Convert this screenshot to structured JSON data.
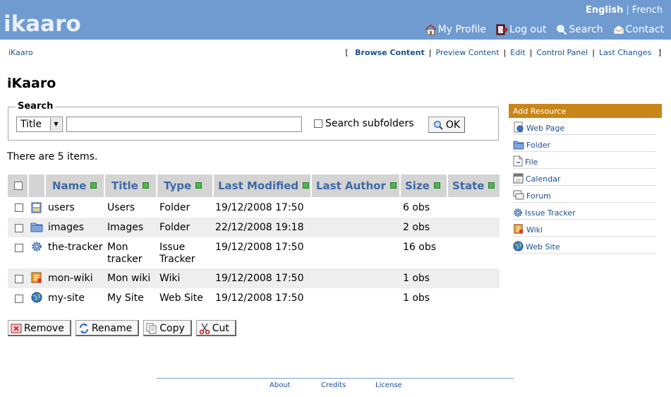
{
  "header": {
    "logo": "ikaaro",
    "languages": [
      {
        "label": "English",
        "active": true
      },
      {
        "label": "French",
        "active": false
      }
    ],
    "nav": [
      {
        "label": "My Profile",
        "icon": "house-icon"
      },
      {
        "label": "Log out",
        "icon": "logout-icon"
      },
      {
        "label": "Search",
        "icon": "search-icon"
      },
      {
        "label": "Contact",
        "icon": "contact-icon"
      }
    ]
  },
  "breadcrumb": "iKaaro",
  "views": {
    "open_bracket": "[",
    "close_bracket": "]",
    "items": [
      {
        "label": "Browse Content",
        "current": true
      },
      {
        "label": "Preview Content",
        "current": false
      },
      {
        "label": "Edit",
        "current": false
      },
      {
        "label": "Control Panel",
        "current": false
      },
      {
        "label": "Last Changes",
        "current": false
      }
    ]
  },
  "page_title": "iKaaro",
  "search": {
    "legend": "Search",
    "field_select": "Title",
    "query_value": "",
    "subfolders_label": "Search subfolders",
    "ok_label": "OK"
  },
  "item_count_text": "There are 5 items.",
  "table": {
    "columns": [
      "Name",
      "Title",
      "Type",
      "Last Modified",
      "Last Author",
      "Size",
      "State"
    ],
    "rows": [
      {
        "name": "users",
        "title": "Users",
        "type": "Folder",
        "modified": "19/12/2008 17:50",
        "author": "",
        "size": "6 obs",
        "state": "",
        "icon": "users-folder-icon"
      },
      {
        "name": "images",
        "title": "Images",
        "type": "Folder",
        "modified": "22/12/2008 19:18",
        "author": "",
        "size": "2 obs",
        "state": "",
        "icon": "folder-icon"
      },
      {
        "name": "the-tracker",
        "title": "Mon tracker",
        "type": "Issue Tracker",
        "modified": "19/12/2008 17:50",
        "author": "",
        "size": "16 obs",
        "state": "",
        "icon": "tracker-gear-icon"
      },
      {
        "name": "mon-wiki",
        "title": "Mon wiki",
        "type": "Wiki",
        "modified": "19/12/2008 17:50",
        "author": "",
        "size": "1 obs",
        "state": "",
        "icon": "wiki-icon"
      },
      {
        "name": "my-site",
        "title": "My Site",
        "type": "Web Site",
        "modified": "19/12/2008 17:50",
        "author": "",
        "size": "1 obs",
        "state": "",
        "icon": "globe-icon"
      }
    ]
  },
  "actions": [
    {
      "label": "Remove",
      "icon": "remove-icon"
    },
    {
      "label": "Rename",
      "icon": "rename-icon"
    },
    {
      "label": "Copy",
      "icon": "copy-icon"
    },
    {
      "label": "Cut",
      "icon": "scissors-icon"
    }
  ],
  "sidebar": {
    "title": "Add Resource",
    "items": [
      {
        "label": "Web Page",
        "icon": "webpage-icon"
      },
      {
        "label": "Folder",
        "icon": "folder-icon"
      },
      {
        "label": "File",
        "icon": "file-icon"
      },
      {
        "label": "Calendar",
        "icon": "calendar-icon"
      },
      {
        "label": "Forum",
        "icon": "forum-icon"
      },
      {
        "label": "Issue Tracker",
        "icon": "tracker-gear-icon"
      },
      {
        "label": "Wiki",
        "icon": "wiki-icon"
      },
      {
        "label": "Web Site",
        "icon": "globe-icon"
      }
    ]
  },
  "footer": [
    "About",
    "Credits",
    "License"
  ],
  "colors": {
    "header_bg": "#6f9bd1",
    "link": "#2a5ea8",
    "sidebar_header": "#c8861a",
    "table_header_bg": "#d4d4d4"
  }
}
